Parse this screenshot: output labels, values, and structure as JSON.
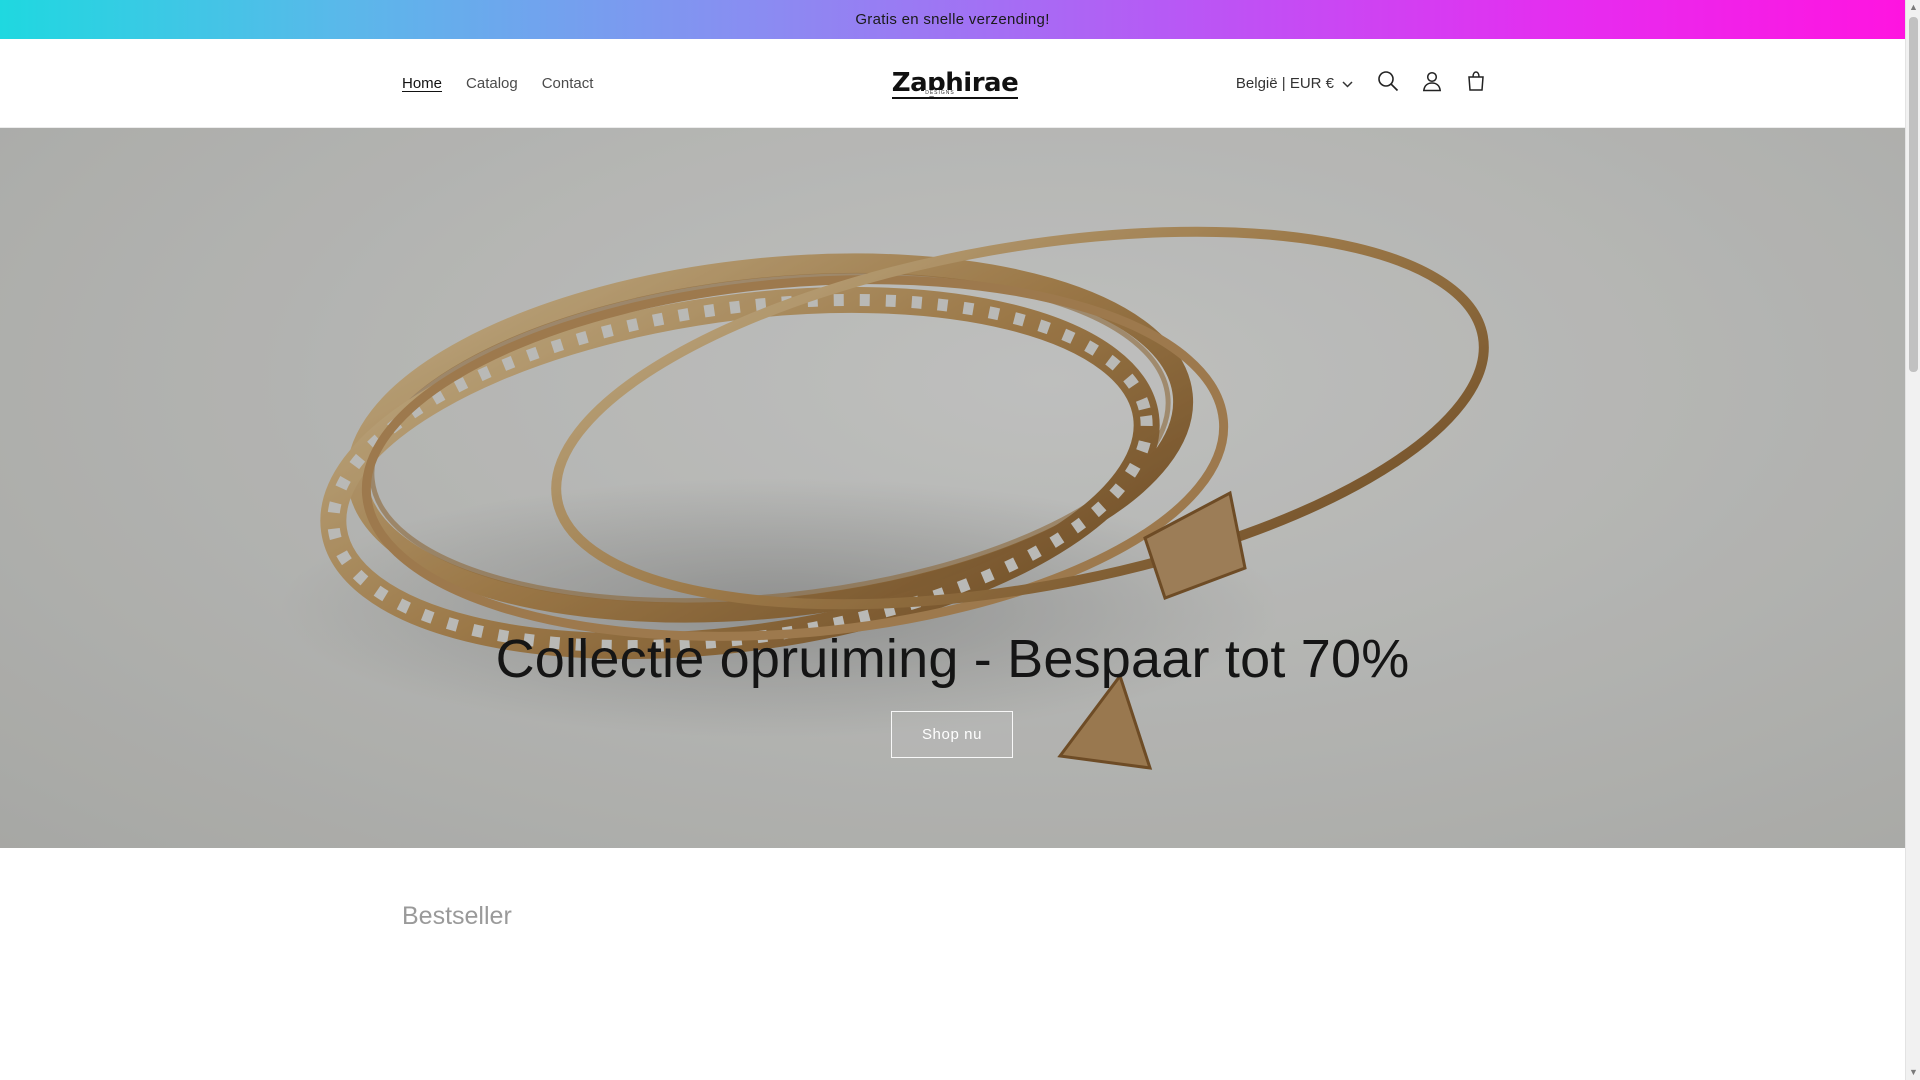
{
  "announcement": {
    "text": "Gratis en snelle verzending!"
  },
  "header": {
    "nav": [
      {
        "label": "Home",
        "active": true
      },
      {
        "label": "Catalog",
        "active": false
      },
      {
        "label": "Contact",
        "active": false
      }
    ],
    "logo": {
      "main": "Zaphirae",
      "sub": "DESIGNS"
    },
    "country_selector": {
      "label": "België | EUR €"
    },
    "icons": [
      "search-icon",
      "account-icon",
      "cart-icon"
    ]
  },
  "hero": {
    "title": "Collectie opruiming - Bespaar tot 70%",
    "button_label": "Shop nu"
  },
  "bestseller": {
    "title": "Bestseller"
  },
  "colors": {
    "announcement_gradient_start": "#1fd8e0",
    "announcement_gradient_end": "#ff14e0",
    "text": "#121212",
    "hero_button_border": "#ffffff"
  }
}
